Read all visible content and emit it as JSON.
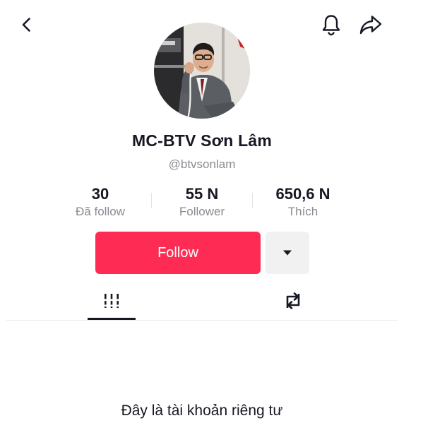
{
  "header": {
    "back_icon": "chevron-left-icon",
    "bell_icon": "bell-icon",
    "share_icon": "share-arrow-icon"
  },
  "profile": {
    "display_name": "MC-BTV Sơn Lâm",
    "username": "@btvsonlam",
    "avatar_icon": "profile-photo"
  },
  "stats": [
    {
      "value": "30",
      "label": "Đã follow"
    },
    {
      "value": "55 N",
      "label": "Follower"
    },
    {
      "value": "650,6 N",
      "label": "Thích"
    }
  ],
  "actions": {
    "follow_label": "Follow",
    "follow_color": "#fe2c55",
    "more_icon": "caret-down-icon"
  },
  "tabs": [
    {
      "icon": "videos-grid-icon",
      "selected": true
    },
    {
      "icon": "repost-icon",
      "selected": false
    }
  ],
  "private_notice": {
    "title": "Đây là tài khoản riêng tư",
    "subtitle": ""
  }
}
